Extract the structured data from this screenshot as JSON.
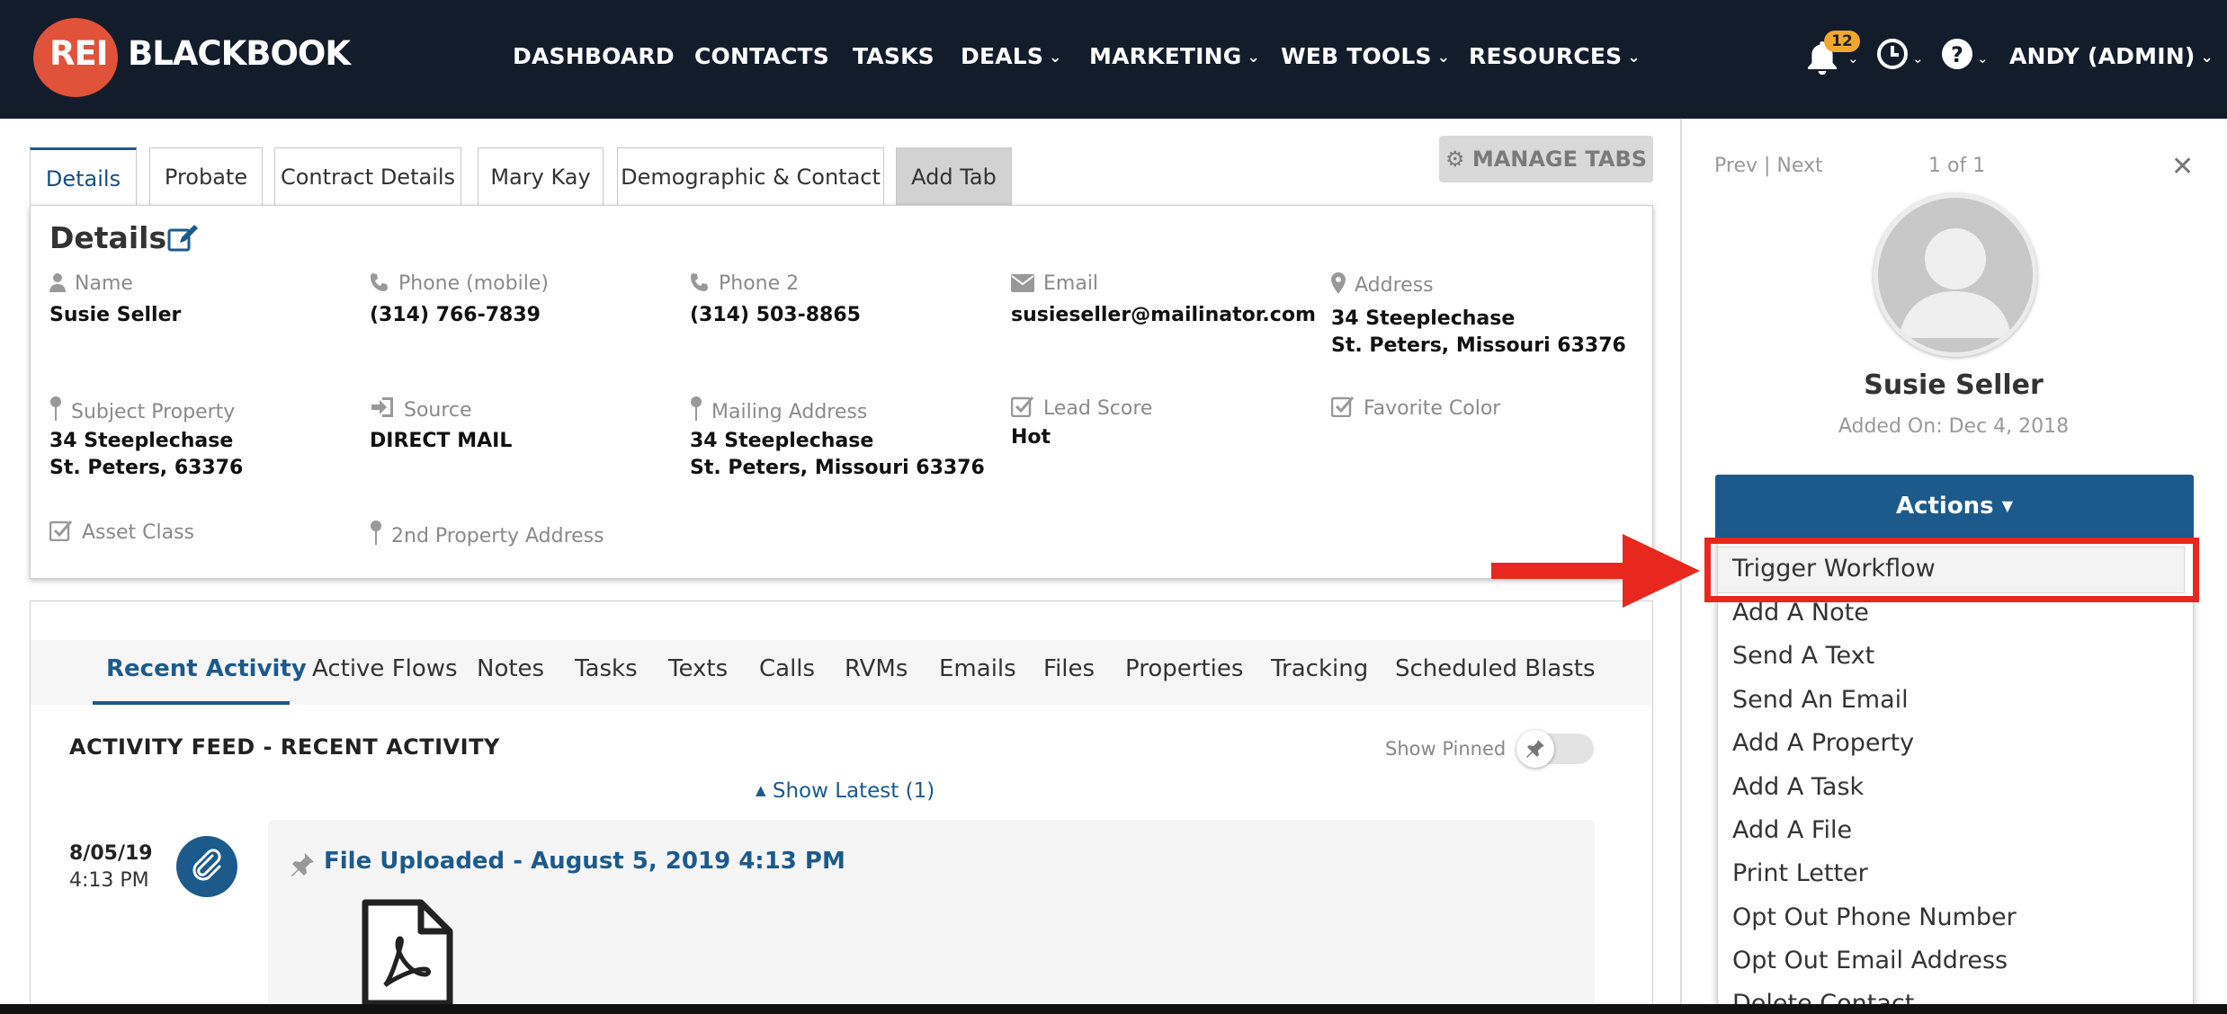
{
  "nav": {
    "logo_rei": "REI",
    "logo_blackbook": "BLACKBOOK",
    "items": [
      {
        "label": "DASHBOARD",
        "has_caret": false
      },
      {
        "label": "CONTACTS",
        "has_caret": false
      },
      {
        "label": "TASKS",
        "has_caret": false
      },
      {
        "label": "DEALS",
        "has_caret": true
      },
      {
        "label": "MARKETING",
        "has_caret": true
      },
      {
        "label": "WEB TOOLS",
        "has_caret": true
      },
      {
        "label": "RESOURCES",
        "has_caret": true
      }
    ],
    "notifications_count": "12",
    "user": "ANDY (ADMIN)",
    "icons": [
      "bell-icon",
      "clock-icon",
      "help-icon"
    ]
  },
  "tabs": {
    "items": [
      "Details",
      "Probate",
      "Contract Details",
      "Mary Kay",
      "Demographic & Contact",
      "Add Tab"
    ],
    "active": "Details",
    "manage_label": "MANAGE TABS"
  },
  "details": {
    "title": "Details",
    "fields": {
      "name": {
        "label": "Name",
        "value": "Susie Seller",
        "icon": "user-icon"
      },
      "phone": {
        "label": "Phone  (mobile)",
        "value": "(314) 766-7839",
        "icon": "phone-icon"
      },
      "phone2": {
        "label": "Phone 2",
        "value": "(314) 503-8865",
        "icon": "phone-icon"
      },
      "email": {
        "label": "Email",
        "value": "susieseller@mailinator.com",
        "icon": "envelope-icon"
      },
      "address": {
        "label": "Address",
        "line1": "34 Steeplechase",
        "line2": "St. Peters, Missouri 63376",
        "icon": "map-marker-icon"
      },
      "subject_property": {
        "label": "Subject Property",
        "line1": "34 Steeplechase",
        "line2": "St. Peters, 63376",
        "icon": "pin-icon"
      },
      "source": {
        "label": "Source",
        "value": "DIRECT MAIL",
        "icon": "sign-in-icon"
      },
      "mailing_address": {
        "label": "Mailing Address",
        "line1": "34 Steeplechase",
        "line2": "St. Peters, Missouri 63376",
        "icon": "pin-icon"
      },
      "lead_score": {
        "label": "Lead Score",
        "value": "Hot",
        "icon": "checkbox-icon"
      },
      "favorite_color": {
        "label": "Favorite Color",
        "icon": "checkbox-icon"
      },
      "asset_class": {
        "label": "Asset Class",
        "icon": "checkbox-icon"
      },
      "second_property": {
        "label": "2nd Property Address",
        "icon": "pin-icon"
      }
    }
  },
  "activity": {
    "subtabs": [
      "Recent Activity",
      "Active Flows",
      "Notes",
      "Tasks",
      "Texts",
      "Calls",
      "RVMs",
      "Emails",
      "Files",
      "Properties",
      "Tracking",
      "Scheduled Blasts"
    ],
    "active_subtab": "Recent Activity",
    "feed_title": "ACTIVITY FEED - RECENT ACTIVITY",
    "show_pinned": "Show Pinned",
    "show_latest": "Show Latest (1)",
    "item": {
      "date": "8/05/19",
      "time": "4:13 PM",
      "title": "File Uploaded - August 5, 2019 4:13 PM"
    }
  },
  "panel": {
    "prev": "Prev",
    "separator": "|",
    "next": "Next",
    "count": "1 of 1",
    "contact_name": "Susie Seller",
    "added_on": "Added On: Dec 4, 2018",
    "actions_label": "Actions",
    "menu": [
      "Trigger Workflow",
      "Add A Note",
      "Send A Text",
      "Send An Email",
      "Add A Property",
      "Add A Task",
      "Add A File",
      "Print Letter",
      "Opt Out Phone Number",
      "Opt Out Email Address",
      "Delete Contact"
    ]
  },
  "colors": {
    "nav_bg": "#131c2b",
    "brand_orange": "#e0523a",
    "primary_blue": "#1d5a8c",
    "highlight_red": "#e8281e",
    "badge_yellow": "#f0a92e"
  }
}
